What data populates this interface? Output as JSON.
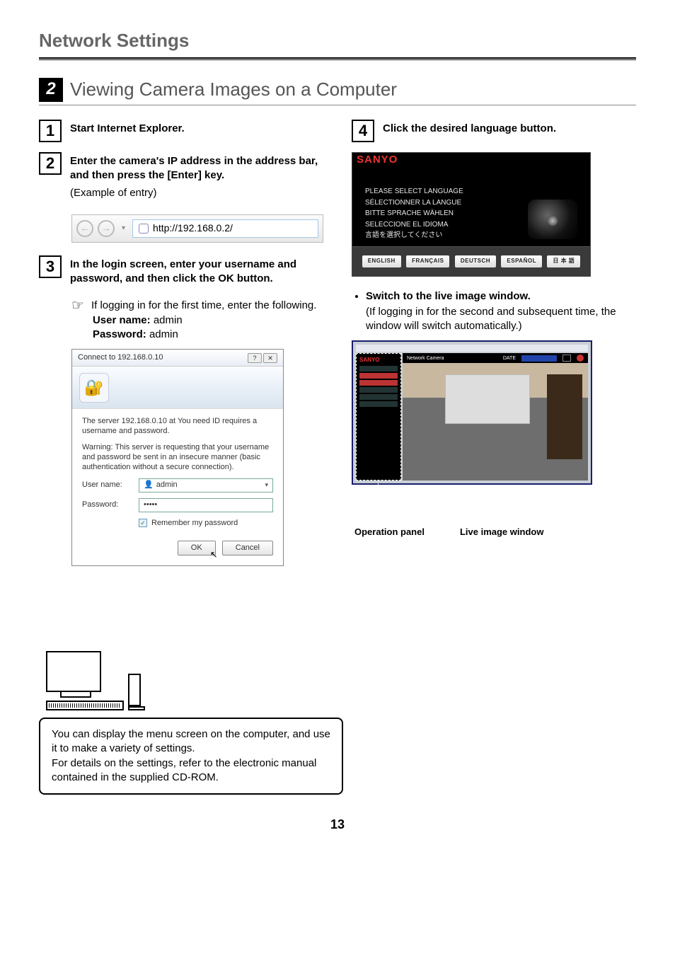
{
  "page_title": "Network Settings",
  "section": {
    "number": "2",
    "title": "Viewing Camera Images on a Computer"
  },
  "steps": {
    "s1": {
      "num": "1",
      "title": "Start Internet Explorer."
    },
    "s2": {
      "num": "2",
      "title": "Enter the camera's IP address in the address bar, and then press the [Enter] key.",
      "note": "(Example of entry)"
    },
    "s3": {
      "num": "3",
      "title": "In the login screen, enter your username and password, and then click the OK button."
    },
    "s4": {
      "num": "4",
      "title": "Click the desired language button."
    }
  },
  "address_bar": {
    "url": "http://192.168.0.2/"
  },
  "login_note": {
    "intro": "If logging in for the first time, enter the following.",
    "user_label": "User name:",
    "user_value": "admin",
    "pass_label": "Password:",
    "pass_value": "admin"
  },
  "login_dialog": {
    "title": "Connect to 192.168.0.10",
    "msg1": "The server 192.168.0.10 at You need ID requires a username and password.",
    "msg2": "Warning: This server is requesting that your username and password be sent in an insecure manner (basic authentication without a secure connection).",
    "user_label": "User name:",
    "user_value": "admin",
    "pass_label": "Password:",
    "pass_value": "•••••",
    "remember": "Remember my password",
    "ok": "OK",
    "cancel": "Cancel",
    "help": "?",
    "close": "✕"
  },
  "lang_panel": {
    "brand": "SANYO",
    "l1": "PLEASE SELECT LANGUAGE",
    "l2": "SÉLECTIONNER LA LANGUE",
    "l3": "BITTE SPRACHE WÄHLEN",
    "l4": "SELECCIONE EL IDIOMA",
    "l5": "言語を選択してください",
    "btns": {
      "en": "ENGLISH",
      "fr": "FRANÇAIS",
      "de": "DEUTSCH",
      "es": "ESPAÑOL",
      "jp": "日 本 語"
    }
  },
  "bullet": {
    "title": "Switch to the live image window.",
    "sub": "(If logging in for the second and subsequent time, the window will switch automatically.)"
  },
  "live_fig": {
    "header": "Network Camera",
    "date_label": "DATE",
    "label_left": "Operation panel",
    "label_right": "Live image window",
    "brand": "SANYO"
  },
  "callout": {
    "p1": "You can display the menu screen on the computer, and use it to make a variety of settings.",
    "p2": "For details on the settings, refer to the electronic manual contained in the supplied CD-ROM."
  },
  "page_number": "13"
}
